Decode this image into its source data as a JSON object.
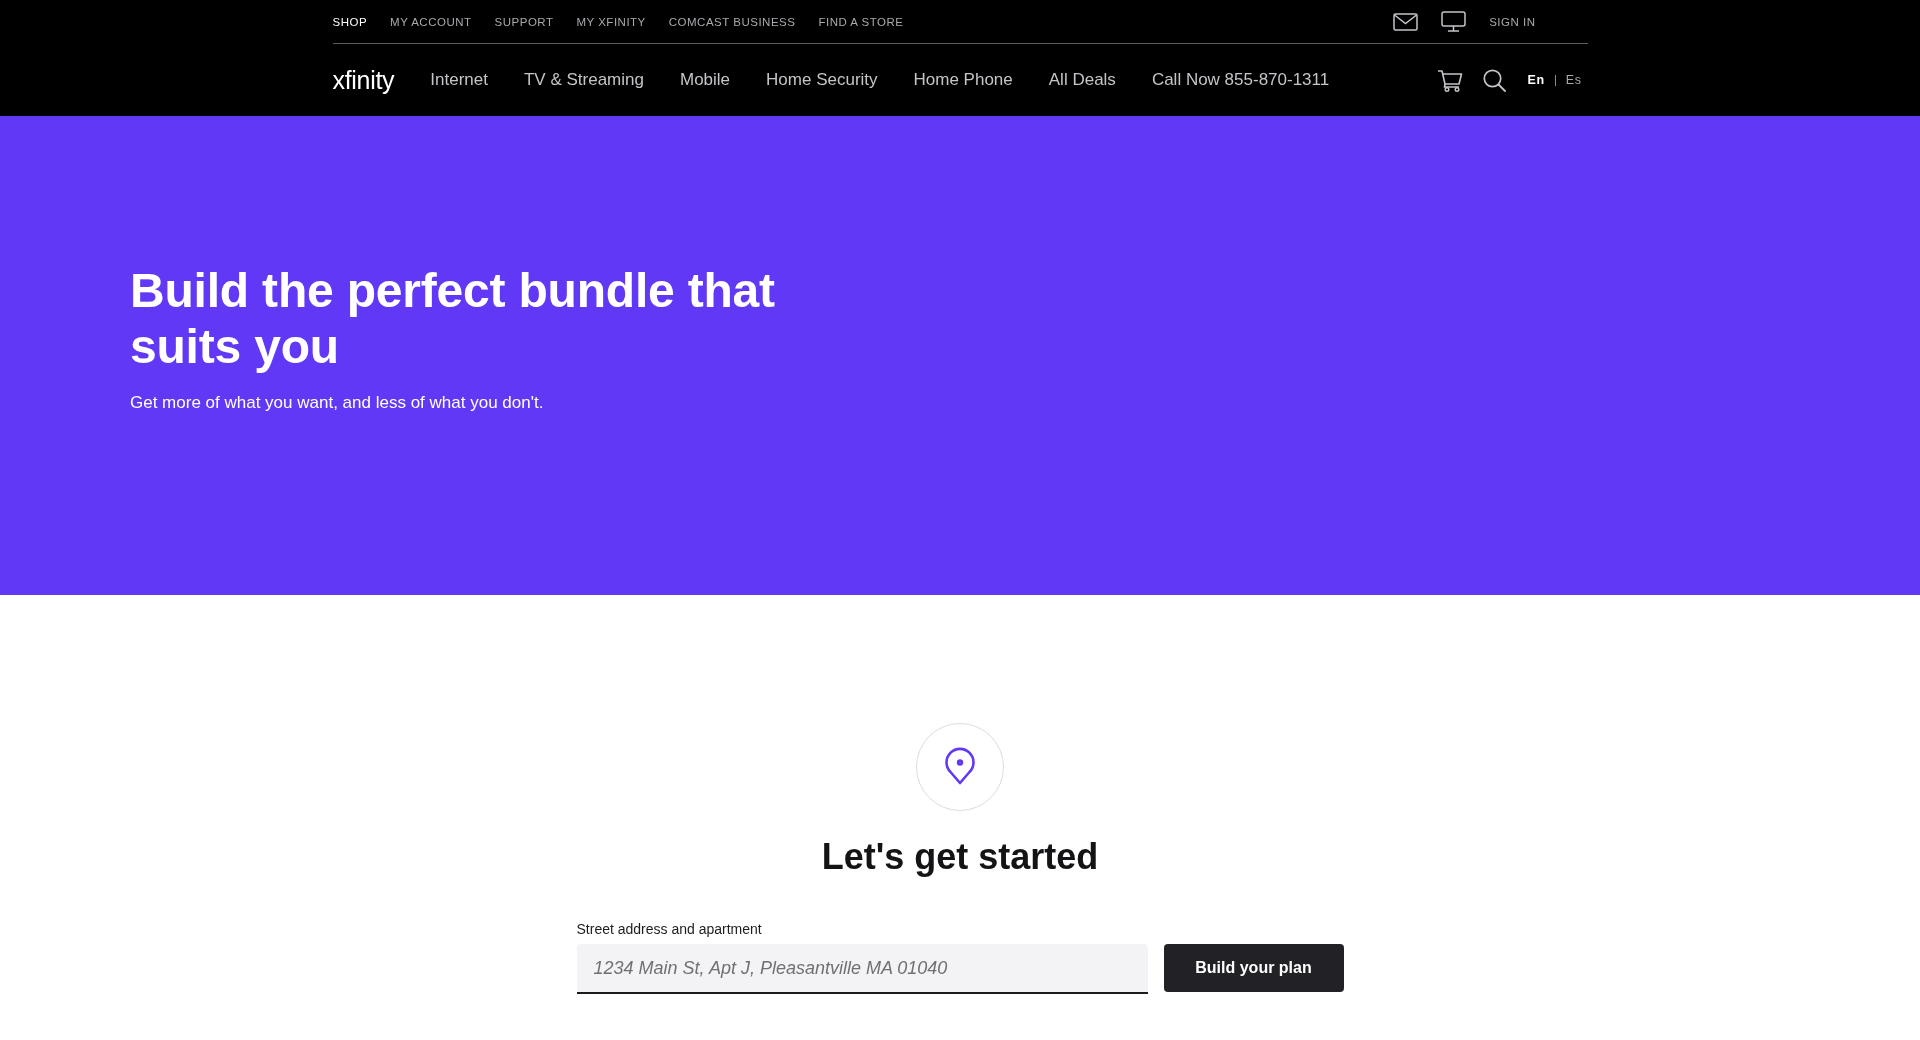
{
  "utility_nav": {
    "links": [
      {
        "label": "SHOP",
        "selected": true
      },
      {
        "label": "MY ACCOUNT",
        "selected": false
      },
      {
        "label": "SUPPORT",
        "selected": false
      },
      {
        "label": "MY XFINITY",
        "selected": false
      },
      {
        "label": "COMCAST BUSINESS",
        "selected": false
      },
      {
        "label": "FIND A STORE",
        "selected": false
      }
    ],
    "sign_in": "SIGN IN"
  },
  "main_nav": {
    "logo": "xfinity",
    "items": [
      "Internet",
      "TV & Streaming",
      "Mobile",
      "Home Security",
      "Home Phone",
      "All Deals",
      "Call Now 855-870-1311"
    ],
    "languages": [
      {
        "label": "En",
        "selected": true
      },
      {
        "label": "Es",
        "selected": false
      }
    ]
  },
  "hero": {
    "title": "Build the perfect bundle that suits you",
    "subtitle": "Get more of what you want, and less of what you don't."
  },
  "address_form": {
    "heading": "Let's get started",
    "label": "Street address and apartment",
    "placeholder": "1234 Main St, Apt J, Pleasantville MA 01040",
    "button": "Build your plan"
  }
}
